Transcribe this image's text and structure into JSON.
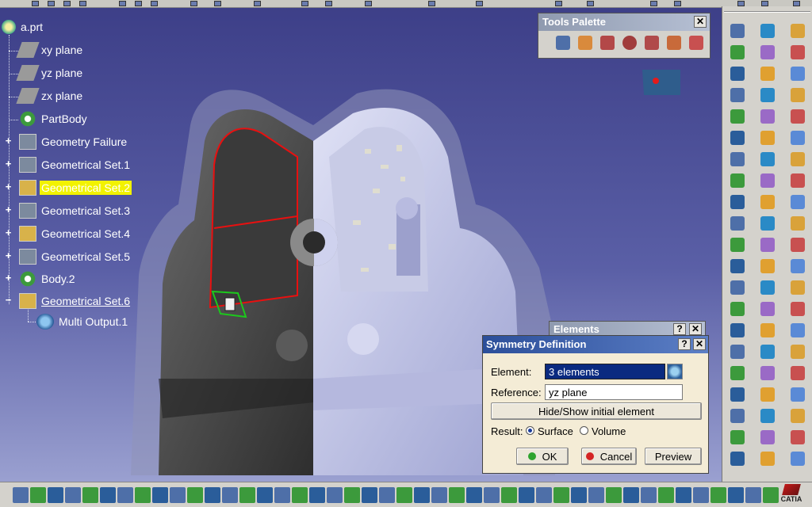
{
  "tree": {
    "root": "a.prt",
    "items": [
      {
        "label": "xy plane"
      },
      {
        "label": "yz plane"
      },
      {
        "label": "zx plane"
      },
      {
        "label": "PartBody"
      },
      {
        "label": "Geometry Failure"
      },
      {
        "label": "Geometrical Set.1"
      },
      {
        "label": "Geometrical Set.2"
      },
      {
        "label": "Geometrical Set.3"
      },
      {
        "label": "Geometrical Set.4"
      },
      {
        "label": "Geometrical Set.5"
      },
      {
        "label": "Body.2"
      },
      {
        "label": "Geometrical Set.6"
      },
      {
        "label": "Multi Output.1"
      }
    ]
  },
  "tools_palette": {
    "title": "Tools Palette",
    "close": "✕"
  },
  "elements_window": {
    "title": "Elements",
    "help": "?",
    "close": "✕"
  },
  "symmetry_dialog": {
    "title": "Symmetry Definition",
    "help": "?",
    "close": "✕",
    "element_label": "Element:",
    "element_value": "3 elements",
    "reference_label": "Reference:",
    "reference_value": "yz plane",
    "hide_show_button": "Hide/Show initial element",
    "result_label": "Result:",
    "surface_option": "Surface",
    "volume_option": "Volume",
    "ok_button": "OK",
    "cancel_button": "Cancel",
    "preview_button": "Preview"
  },
  "colors": {
    "viewport_bg": "#3c3f8a",
    "selection_highlight": "#f2f200",
    "dialog_title": "#2c4f9a",
    "part_dark": "#4a4a4a",
    "part_light": "#bfc3e6",
    "sketch_red": "#e81010"
  },
  "brand": {
    "logo_text": "CATIA"
  }
}
